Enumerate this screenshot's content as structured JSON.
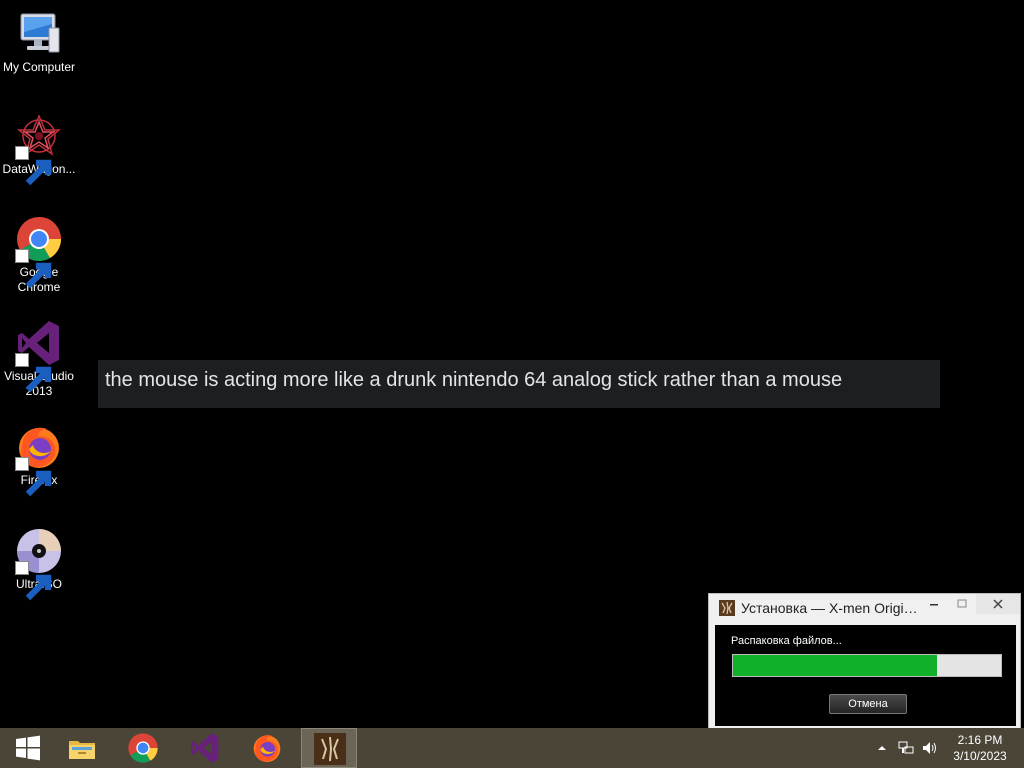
{
  "desktop": {
    "icons": [
      {
        "label": "My Computer",
        "icon": "computer-icon"
      },
      {
        "label": "DataWagon...",
        "icon": "datawagon-icon"
      },
      {
        "label": "Google Chrome",
        "icon": "chrome-icon"
      },
      {
        "label": "Visual Studio 2013",
        "icon": "visual-studio-icon"
      },
      {
        "label": "Firefox",
        "icon": "firefox-icon"
      },
      {
        "label": "UltraISO",
        "icon": "ultraiso-icon"
      }
    ]
  },
  "caption": {
    "text": "the mouse is acting more like a drunk nintendo 64 analog stick rather than a mouse"
  },
  "installer": {
    "title": "Установка — X-men Origins: Wolverine",
    "status": "Распаковка файлов...",
    "progress_fraction": 0.76,
    "cancel_label": "Отмена",
    "accent_color": "#10b02a"
  },
  "taskbar": {
    "items": [
      "start-icon",
      "file-explorer-icon",
      "chrome-icon",
      "visual-studio-icon",
      "firefox-icon",
      "wolverine-installer-icon"
    ],
    "tray": [
      "show-hidden-icons-icon",
      "network-icon",
      "volume-icon"
    ],
    "clock": {
      "time": "2:16 PM",
      "date": "3/10/2023"
    }
  }
}
